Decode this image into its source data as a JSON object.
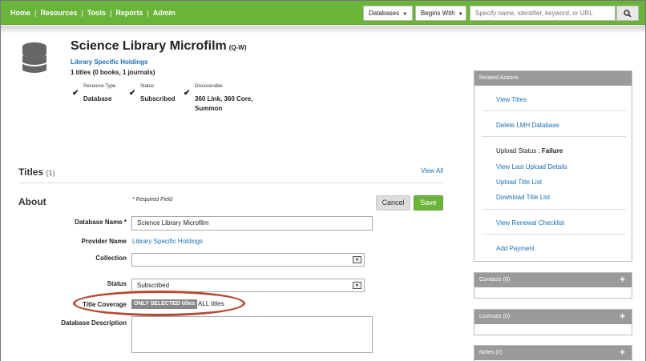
{
  "nav": {
    "items": [
      "Home",
      "Resources",
      "Tools",
      "Reports",
      "Admin"
    ],
    "separator": "|",
    "db_select": "Databases",
    "mode_select": "Begins With",
    "search_placeholder": "Specify name, identifier, keyword, or URL",
    "search_icon": "magnifier-icon"
  },
  "header": {
    "title": "Science Library Microfilm",
    "code": "(Q-W)",
    "provider": "Library Specific Holdings",
    "titles_count": "1 titles (0 books, 1 journals)",
    "meta": [
      {
        "label": "Resource Type",
        "value": "Database"
      },
      {
        "label": "Status",
        "value": "Subscribed"
      },
      {
        "label": "Discoverable",
        "value_lines": [
          "360 Link, 360 Core,",
          "Summon"
        ]
      }
    ]
  },
  "titles_section": {
    "title": "Titles",
    "count": "(1)",
    "view_all": "View All"
  },
  "about": {
    "title": "About",
    "required_note": "* Required Field",
    "cancel": "Cancel",
    "save": "Save",
    "fields": {
      "database_name_label": "Database Name *",
      "database_name_value": "Science Library Microfilm",
      "provider_label": "Provider Name",
      "provider_value": "Library Specific Holdings",
      "collection_label": "Collection",
      "collection_value": "",
      "status_label": "Status",
      "status_value": "Subscribed",
      "title_coverage_label": "Title Coverage",
      "title_coverage_selected": "ONLY SELECTED titles",
      "title_coverage_alt": "ALL titles",
      "description_label": "Database Description"
    }
  },
  "related_actions": {
    "header": "Related Actions",
    "view_titles": "View Titles",
    "delete_lmh": "Delete LMH Database",
    "upload_status_label": "Upload Status : ",
    "upload_status_value": "Failure",
    "view_last_upload": "View Last Upload Details",
    "upload_title_list": "Upload Title List",
    "download_title_list": "Download Title List",
    "view_renewal": "View Renewal Checklist",
    "add_payment": "Add Payment"
  },
  "side_panels": [
    {
      "label": "Contacts (0)",
      "plus": "+"
    },
    {
      "label": "Licenses (0)",
      "plus": "+"
    },
    {
      "label": "Notes (0)",
      "plus": "+"
    }
  ],
  "colors": {
    "nav_green": "#6bb43a",
    "link_blue": "#1a6fb5",
    "annotation_red": "#b44a32"
  }
}
